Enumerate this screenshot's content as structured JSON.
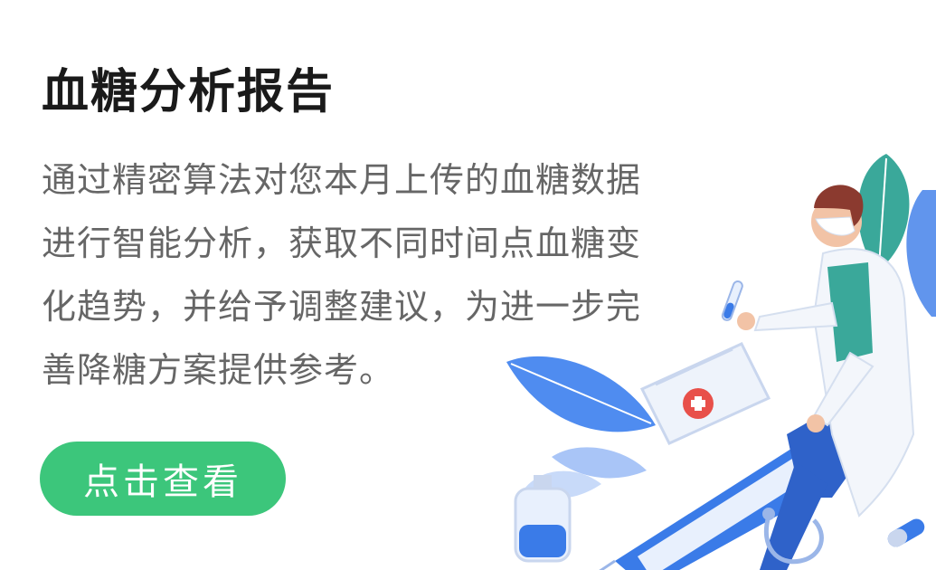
{
  "card": {
    "title": "血糖分析报告",
    "description": "通过精密算法对您本月上传的血糖数据进行智能分析，获取不同时间点血糖变化趋势，并给予调整建议，为进一步完善降糖方案提供参考。",
    "cta_label": "点击查看"
  },
  "colors": {
    "accent": "#3cc67b",
    "title": "#1a1a1a",
    "body_text": "#666666",
    "illustration_blue": "#3a7be8",
    "illustration_teal": "#3aa89a"
  },
  "illustration": {
    "icons": [
      "doctor-figure-icon",
      "syringe-icon",
      "leaf-icon",
      "medical-kit-icon",
      "iv-bag-icon",
      "stethoscope-icon",
      "test-tube-icon",
      "pill-icon"
    ]
  }
}
